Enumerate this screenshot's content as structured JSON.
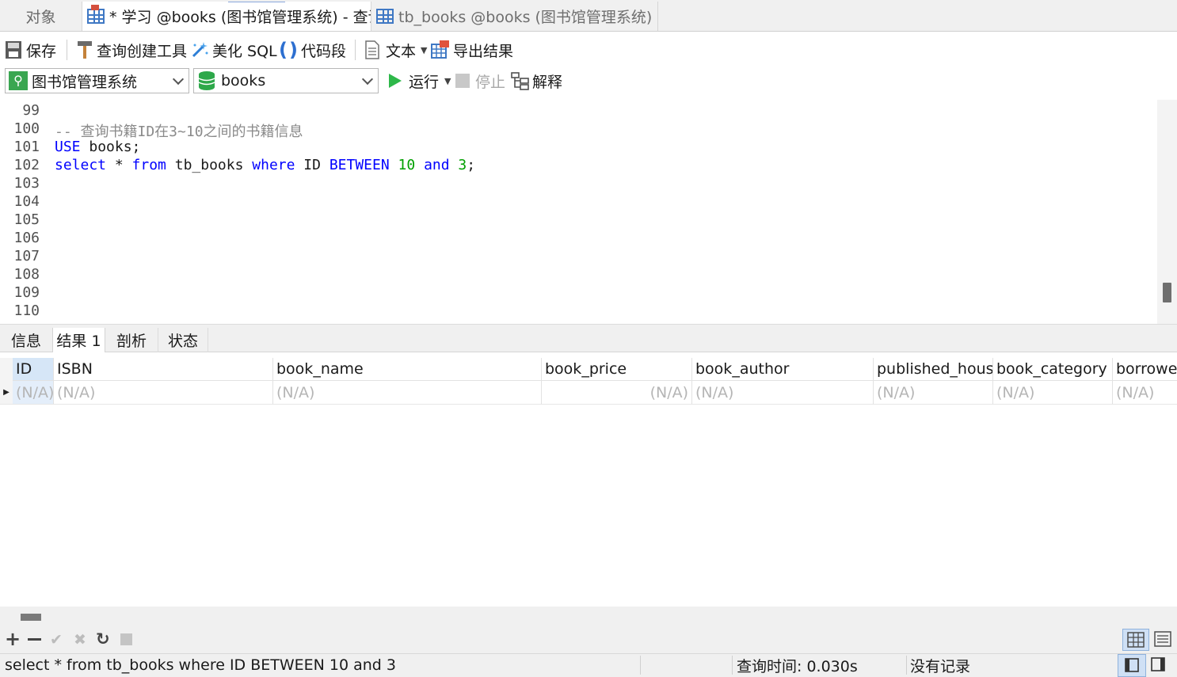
{
  "tabs": [
    {
      "label": "对象"
    },
    {
      "label": "* 学习 @books (图书馆管理系统) - 查询"
    },
    {
      "label": "tb_books @books (图书馆管理系统) -..."
    }
  ],
  "toolbar": {
    "save": "保存",
    "query_builder": "查询创建工具",
    "beautify_sql": "美化 SQL",
    "code_snippet": "代码段",
    "text": "文本",
    "export_results": "导出结果"
  },
  "connection": {
    "selected": "图书馆管理系统"
  },
  "database": {
    "selected": "books"
  },
  "run_bar": {
    "run": "运行",
    "stop": "停止",
    "explain": "解释"
  },
  "editor": {
    "line_numbers": [
      "99",
      "100",
      "101",
      "102",
      "103",
      "104",
      "105",
      "106",
      "107",
      "108",
      "109",
      "110"
    ],
    "comment_line": "-- 查询书籍ID在3~10之间的书籍信息",
    "use_kw": "USE",
    "use_rest": " books;",
    "select_kw": "select",
    "star": " * ",
    "from_kw": "from",
    "table": " tb_books ",
    "where_kw": "where",
    "id": " ID ",
    "between_kw": "BETWEEN",
    "num1": "10",
    "and_kw": "and",
    "num2": "3",
    "semicolon": ";"
  },
  "result_tabs": [
    "信息",
    "结果 1",
    "剖析",
    "状态"
  ],
  "grid": {
    "columns": [
      "ID",
      "ISBN",
      "book_name",
      "book_price",
      "book_author",
      "published_house",
      "book_category",
      "borrower"
    ],
    "null_value": "(N/A)"
  },
  "status": {
    "sql": "select * from tb_books where ID BETWEEN 10 and 3",
    "query_time": "查询时间: 0.030s",
    "records": "没有记录"
  },
  "colors": {
    "keyword": "#0000ff",
    "number": "#00a000",
    "comment": "#8a8a8a",
    "accent": "#3f78c4"
  }
}
